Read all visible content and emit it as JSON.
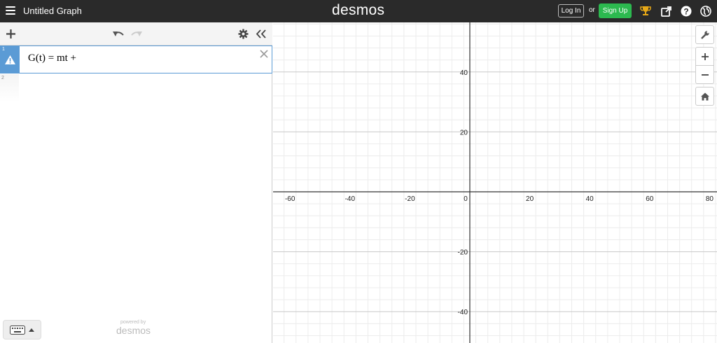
{
  "header": {
    "title": "Untitled Graph",
    "logo": "desmos",
    "login_label": "Log In",
    "or_label": "or",
    "signup_label": "Sign Up",
    "icons": [
      "menu-icon",
      "trophy-icon",
      "share-icon",
      "help-icon",
      "globe-icon"
    ]
  },
  "sidebar": {
    "toolbar_icons": [
      "add-icon",
      "undo-icon",
      "redo-icon",
      "gear-icon",
      "collapse-icon"
    ],
    "expressions": [
      {
        "index": "1",
        "latex": "G(t) = mt +",
        "status": "warning"
      },
      {
        "index": "2",
        "latex": ""
      }
    ],
    "powered_by": "powered by",
    "powered_logo": "desmos"
  },
  "graph": {
    "x_ticks": [
      "-60",
      "-40",
      "-20",
      "0",
      "20",
      "40",
      "60",
      "80"
    ],
    "y_ticks": [
      "40",
      "20",
      "-20",
      "-40"
    ],
    "controls": [
      "wrench-icon",
      "zoom-in-icon",
      "zoom-out-icon",
      "home-icon"
    ]
  },
  "colors": {
    "header": "#2a2a2a",
    "accent": "#5b9bd5",
    "signup": "#2cb94f"
  }
}
